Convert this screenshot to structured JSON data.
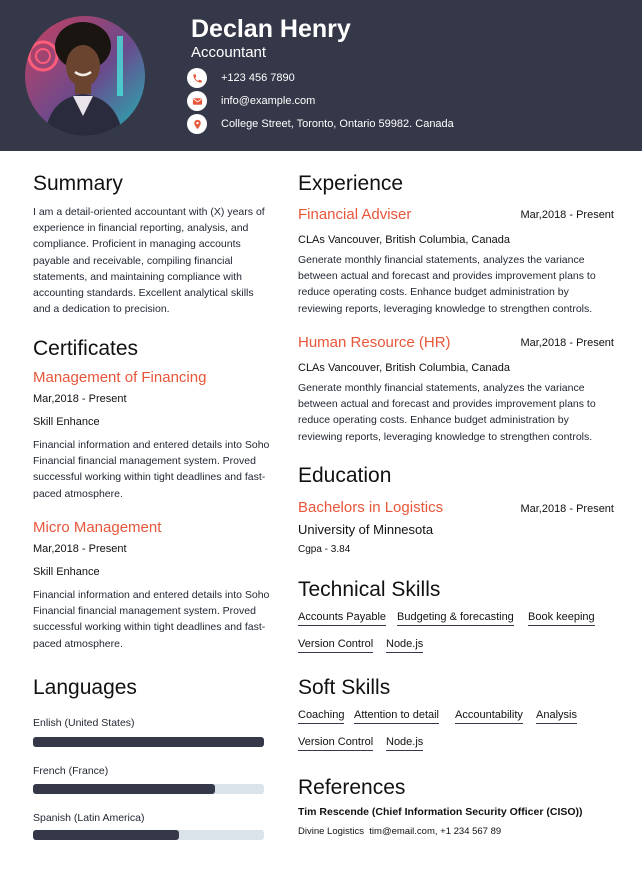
{
  "header": {
    "name": "Declan Henry",
    "title": "Accountant",
    "phone": "+123 456 7890",
    "email": "info@example.com",
    "address": "College Street, Toronto, Ontario 59982. Canada"
  },
  "summary": {
    "heading": "Summary",
    "text": "I am a detail-oriented accountant with (X) years of experience in financial reporting, analysis, and compliance. Proficient in managing accounts payable and receivable, compiling financial statements, and maintaining compliance with accounting standards. Excellent analytical skills and a dedication to precision."
  },
  "certificates": {
    "heading": "Certificates",
    "items": [
      {
        "title": "Management of Financing",
        "date": "Mar,2018 - Present",
        "org": "Skill Enhance",
        "desc": "Financial information and entered details into Soho Financial financial management system. Proved successful working within tight deadlines and fast-paced atmosphere."
      },
      {
        "title": "Micro Management",
        "date": "Mar,2018 - Present",
        "org": "Skill Enhance",
        "desc": "Financial information and entered details into Soho Financial financial management system. Proved successful working within tight deadlines and fast-paced atmosphere."
      }
    ]
  },
  "languages": {
    "heading": "Languages",
    "items": [
      {
        "name": "Enlish (United States)",
        "level": 1.0
      },
      {
        "name": "French (France)",
        "level": 0.79
      },
      {
        "name": "Spanish (Latin America)",
        "level": 0.63
      }
    ]
  },
  "experience": {
    "heading": "Experience",
    "items": [
      {
        "role": "Financial Adviser",
        "date": "Mar,2018 - Present",
        "company": "CLAs Vancouver, British Columbia, Canada",
        "desc": "Generate monthly financial statements, analyzes the variance between actual and forecast and provides improvement plans to reduce operating costs. Enhance budget administration by reviewing reports, leveraging knowledge to strengthen controls."
      },
      {
        "role": "Human Resource (HR)",
        "date": "Mar,2018 - Present",
        "company": "CLAs Vancouver, British Columbia, Canada",
        "desc": "Generate monthly financial statements, analyzes the variance between actual and forecast and provides improvement plans to reduce operating costs. Enhance budget administration by reviewing reports, leveraging knowledge to strengthen controls."
      }
    ]
  },
  "education": {
    "heading": "Education",
    "degree": "Bachelors in Logistics",
    "date": "Mar,2018 - Present",
    "school": "University of Minnesota",
    "cgpa": "Cgpa - 3.84"
  },
  "technical_skills": {
    "heading": "Technical Skills",
    "items": [
      "Accounts Payable",
      "Budgeting & forecasting",
      "Book keeping",
      "Version Control",
      "Node.js"
    ]
  },
  "soft_skills": {
    "heading": "Soft Skills",
    "items": [
      "Coaching",
      "Attention to detail",
      "Accountability",
      "Analysis",
      "Version Control",
      "Node.js"
    ]
  },
  "references": {
    "heading": "References",
    "name": "Tim Rescende (Chief Information Security Officer (CISO))",
    "company": "Divine Logistics",
    "contact": "tim@email.com, +1 234 567 89"
  },
  "colors": {
    "accent": "#e8563a",
    "header_bg": "#353848",
    "bar_bg": "#dbe3ea"
  },
  "icons": {
    "phone": "phone-icon",
    "email": "email-icon",
    "address": "location-pin-icon"
  }
}
